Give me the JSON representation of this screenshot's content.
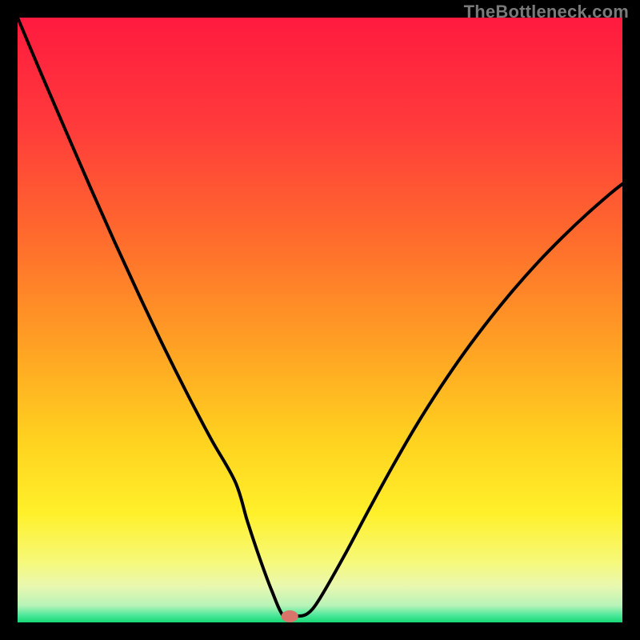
{
  "watermark": "TheBottleneck.com",
  "chart_data": {
    "type": "line",
    "title": "",
    "xlabel": "",
    "ylabel": "",
    "xlim": [
      0,
      100
    ],
    "ylim": [
      0,
      100
    ],
    "grid": false,
    "legend": false,
    "series": [
      {
        "name": "curve",
        "x": [
          0,
          4,
          8,
          12,
          16,
          20,
          24,
          28,
          32,
          36,
          38,
          40,
          42,
          44,
          46,
          48,
          50,
          54,
          58,
          62,
          66,
          70,
          74,
          78,
          82,
          86,
          90,
          94,
          98,
          100
        ],
        "y": [
          100,
          90.5,
          81.2,
          72.0,
          63.0,
          54.3,
          45.9,
          37.9,
          30.3,
          23.2,
          16.7,
          10.7,
          5.3,
          1.0,
          1.0,
          1.5,
          4.0,
          11.0,
          18.5,
          25.8,
          32.7,
          39.0,
          44.8,
          50.1,
          55.0,
          59.5,
          63.6,
          67.4,
          70.9,
          72.5
        ]
      }
    ],
    "marker": {
      "x": 45,
      "y": 1
    },
    "gradient_stops": [
      {
        "offset": 0.0,
        "color": "#ff1a3f"
      },
      {
        "offset": 0.18,
        "color": "#ff3b3b"
      },
      {
        "offset": 0.36,
        "color": "#ff6a2d"
      },
      {
        "offset": 0.54,
        "color": "#ffa024"
      },
      {
        "offset": 0.7,
        "color": "#ffd21f"
      },
      {
        "offset": 0.82,
        "color": "#fff02a"
      },
      {
        "offset": 0.9,
        "color": "#f6f97a"
      },
      {
        "offset": 0.94,
        "color": "#e9f8b0"
      },
      {
        "offset": 0.972,
        "color": "#b8f3b8"
      },
      {
        "offset": 0.988,
        "color": "#4de89a"
      },
      {
        "offset": 1.0,
        "color": "#17d877"
      }
    ]
  }
}
